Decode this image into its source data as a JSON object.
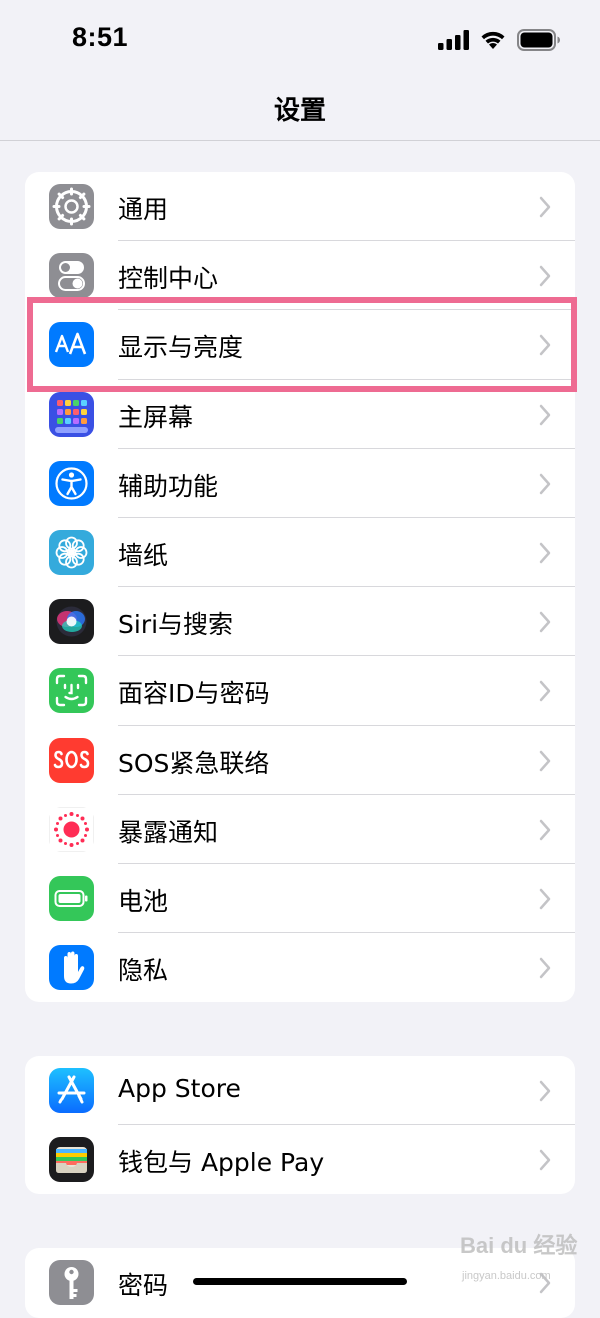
{
  "status_bar": {
    "time": "8:51"
  },
  "nav": {
    "title": "设置"
  },
  "groups": [
    {
      "items": [
        {
          "label": "通用",
          "icon": "gear-icon",
          "color": "#8e8e93"
        },
        {
          "label": "控制中心",
          "icon": "toggle-switches-icon",
          "color": "#8e8e93"
        },
        {
          "label": "显示与亮度",
          "icon": "text-size-aa-icon",
          "color": "#007aff"
        },
        {
          "label": "主屏幕",
          "icon": "home-screen-grid-icon",
          "color": "#3a50e4"
        },
        {
          "label": "辅助功能",
          "icon": "accessibility-person-icon",
          "color": "#007aff"
        },
        {
          "label": "墙纸",
          "icon": "flower-wallpaper-icon",
          "color": "#34aadc"
        },
        {
          "label": "Siri与搜索",
          "icon": "siri-orb-icon",
          "color": "#1c1c1e"
        },
        {
          "label": "面容ID与密码",
          "icon": "face-id-icon",
          "color": "#34c759"
        },
        {
          "label": "SOS紧急联络",
          "icon": "sos-icon",
          "color": "#ff3b30"
        },
        {
          "label": "暴露通知",
          "icon": "exposure-notification-icon",
          "color": "#ffffff"
        },
        {
          "label": "电池",
          "icon": "battery-icon",
          "color": "#34c759"
        },
        {
          "label": "隐私",
          "icon": "hand-privacy-icon",
          "color": "#007aff"
        }
      ]
    },
    {
      "items": [
        {
          "label": "App Store",
          "icon": "app-store-icon",
          "color": "#0a84ff"
        },
        {
          "label": "钱包与 Apple Pay",
          "icon": "wallet-icon",
          "color": "#1c1c1e"
        }
      ]
    },
    {
      "items": [
        {
          "label": "密码",
          "icon": "key-icon",
          "color": "#8e8e93"
        }
      ]
    }
  ],
  "highlight": {
    "color": "#ee6b92",
    "target": "显示与亮度"
  },
  "watermark": {
    "text": "Bai du 经验",
    "sub": "jingyan.baidu.com"
  }
}
